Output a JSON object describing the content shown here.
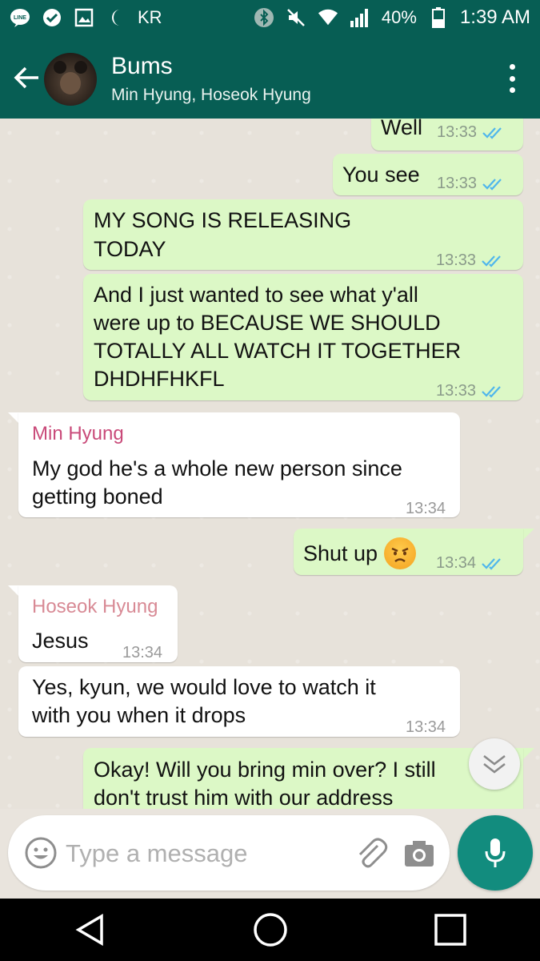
{
  "status_bar": {
    "carrier": "KR",
    "battery": "40%",
    "time": "1:39 AM",
    "icons": [
      "line-app-icon",
      "check-circle-icon",
      "gallery-icon",
      "moon-icon",
      "bluetooth-icon",
      "mute-icon",
      "wifi-icon",
      "signal-icon",
      "battery-icon"
    ]
  },
  "header": {
    "title": "Bums",
    "subtitle": "Min Hyung, Hoseok Hyung"
  },
  "messages": [
    {
      "dir": "out",
      "text": "Well",
      "time": "13:33",
      "ticks": "read"
    },
    {
      "dir": "out",
      "text": "You see",
      "time": "13:33",
      "ticks": "read"
    },
    {
      "dir": "out",
      "text1": "MY SONG IS RELEASING",
      "text2": "TODAY",
      "time": "13:33",
      "ticks": "read"
    },
    {
      "dir": "out",
      "text1": "And I just wanted to see what y'all",
      "text2": "were up to BECAUSE WE SHOULD",
      "text3": "TOTALLY ALL WATCH IT TOGETHER",
      "text4": "DHDHFHKFL",
      "time": "13:33",
      "ticks": "read"
    },
    {
      "dir": "in",
      "sender": "Min Hyung",
      "text1": "My god he's a whole new person since",
      "text2": "getting boned",
      "time": "13:34"
    },
    {
      "dir": "out",
      "text": "Shut up",
      "emoji": "angry-face",
      "time": "13:34",
      "ticks": "read"
    },
    {
      "dir": "in",
      "sender": "Hoseok Hyung",
      "text": "Jesus",
      "time": "13:34"
    },
    {
      "dir": "in",
      "text1": "Yes, kyun, we would love to watch it",
      "text2": "with you when it drops",
      "time": "13:34"
    },
    {
      "dir": "out",
      "text1": "Okay! Will you bring min over? I still",
      "text2": "don't trust him with our address"
    }
  ],
  "colors": {
    "header": "#075e54",
    "outgoing_bubble": "#dcf8c6",
    "incoming_bubble": "#ffffff",
    "sender_min": "#c94a79",
    "sender_hoseok": "#d88a95",
    "read_ticks": "#4fb6ec",
    "mic_button": "#128c7e"
  },
  "composer": {
    "placeholder": "Type a message"
  }
}
